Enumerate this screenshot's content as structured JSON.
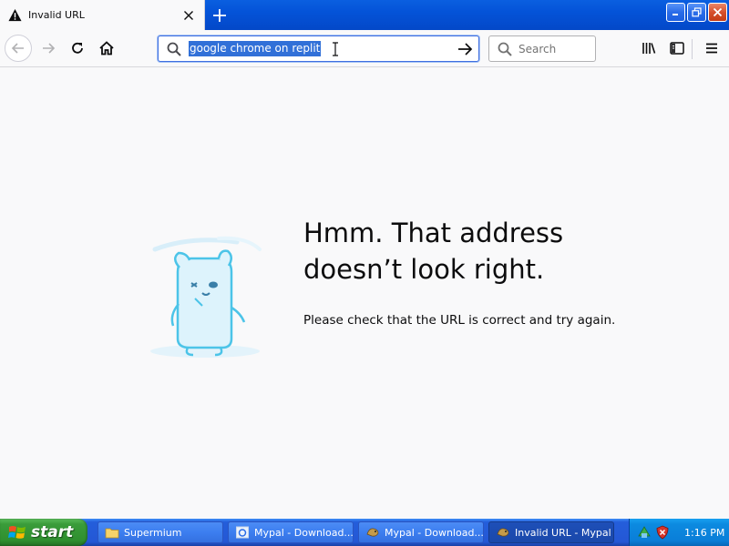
{
  "tab": {
    "title": "Invalid URL"
  },
  "urlbar": {
    "value": "google chrome on replit"
  },
  "searchbar": {
    "placeholder": "Search"
  },
  "error": {
    "heading_line1": "Hmm. That address",
    "heading_line2": "doesn’t look right.",
    "message": "Please check that the URL is correct and try again."
  },
  "taskbar": {
    "start_label": "start",
    "tasks": [
      {
        "label": "Supermium",
        "icon": "folder-icon",
        "active": false
      },
      {
        "label": "Mypal - Download...",
        "icon": "browser-icon",
        "active": false
      },
      {
        "label": "Mypal - Download...",
        "icon": "mypal-icon",
        "active": false
      },
      {
        "label": "Invalid URL - Mypal",
        "icon": "mypal-icon",
        "active": true
      }
    ],
    "clock": "1:16 PM"
  },
  "colors": {
    "titlebar_blue": "#0453d8",
    "selection_blue": "#3170d8",
    "start_green": "#3a9c3a",
    "page_background": "#f9f9fa"
  }
}
